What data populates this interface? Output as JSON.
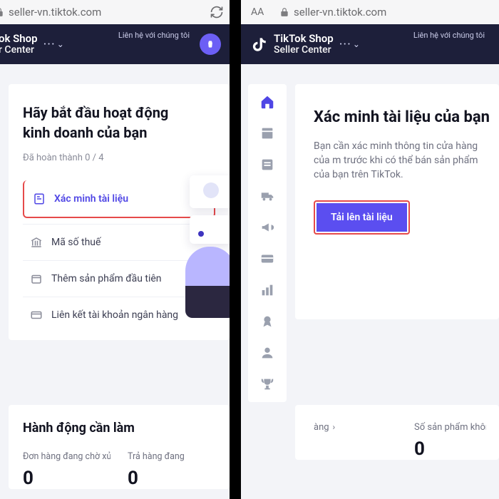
{
  "url": "seller-vn.tiktok.com",
  "brand_line1": "TikTok Shop",
  "brand_line2_short": "r Center",
  "brand_line2": "Seller Center",
  "brand_shop_short": "ok Shop",
  "nav_contact": "Liên hệ với chúng tôi",
  "aa": "AA",
  "left": {
    "title": "Hãy bắt đầu hoạt động kinh doanh của bạn",
    "progress": "Đã hoàn thành 0 / 4",
    "step_verify": "Xác minh tài liệu",
    "step_tax": "Mã số thuế",
    "step_product": "Thêm sản phẩm đầu tiên",
    "step_bank": "Liên kết tài khoản ngân hàng",
    "todo_title": "Hành động cần làm",
    "stat1_label": "Đơn hàng đang chờ xử lý",
    "stat1_value": "0",
    "stat2_label": "Trả hàng đang",
    "stat2_value": "0"
  },
  "right": {
    "title": "Xác minh tài liệu của bạn",
    "desc": "Bạn cần xác minh thông tin cửa hàng của m trước khi có thể bán sản phẩm của bạn trên TikTok.",
    "upload": "Tải lên tài liệu",
    "stat1_label": "àng",
    "stat2_label": "Số sản phẩm không vư…",
    "stat2_value": "0",
    "sidebar": [
      "home",
      "orders",
      "products",
      "shipping",
      "marketing",
      "finance",
      "analytics",
      "rewards",
      "users",
      "trophy"
    ]
  }
}
